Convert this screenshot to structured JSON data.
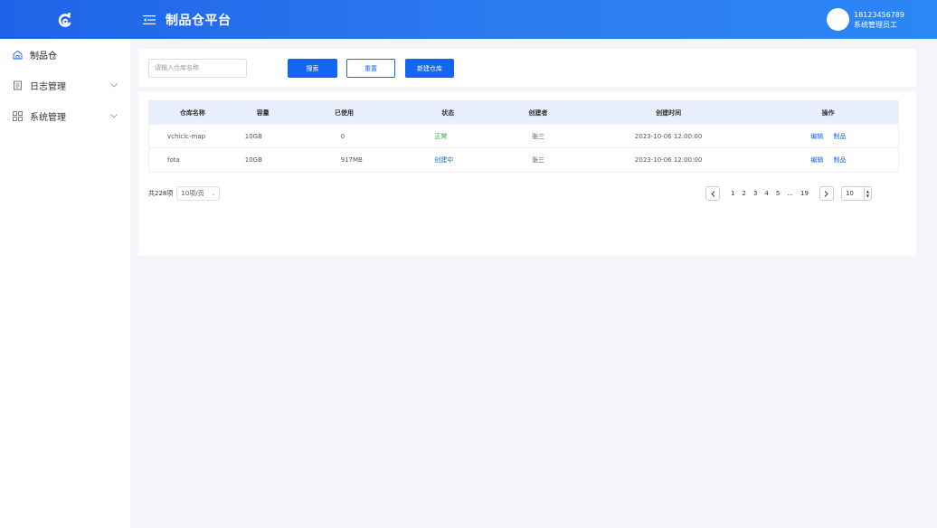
{
  "header": {
    "title": "制品仓平台",
    "user_phone": "18123456789",
    "user_role": "系统管理员工",
    "logo_icon": "brand-logo-icon",
    "menu_icon": "menu-fold-icon"
  },
  "sidebar": {
    "items": [
      {
        "label": "制品仓",
        "icon": "home-icon",
        "active": true
      },
      {
        "label": "日志管理",
        "icon": "document-icon",
        "expandable": true
      },
      {
        "label": "系统管理",
        "icon": "grid-icon",
        "expandable": true
      }
    ]
  },
  "search": {
    "placeholder": "请输入仓库名称",
    "search_label": "搜索",
    "reset_label": "重置",
    "new_label": "新建仓库"
  },
  "table": {
    "columns": [
      "仓库名称",
      "容量",
      "已使用",
      "状态",
      "创建者",
      "创建时间",
      "操作"
    ],
    "rows": [
      {
        "name": "vchiclc-map",
        "capacity": "10GB",
        "used": "0",
        "status": "正常",
        "creator": "张三",
        "created": "2023-10-06 12:00:00",
        "op1": "编辑",
        "op2": "制品"
      },
      {
        "name": "fota",
        "capacity": "10GB",
        "used": "917MB",
        "status": "创建中",
        "creator": "张三",
        "created": "2023-10-06 12:00:00",
        "op1": "编辑",
        "op2": "制品"
      }
    ]
  },
  "pagination": {
    "total": "共228项",
    "page_size": "10项/页",
    "pages": [
      "1",
      "2",
      "3",
      "4",
      "5",
      "...",
      "19"
    ],
    "jump_value": "10"
  },
  "colors": {
    "primary": "#1466f4",
    "status_ok": "#1ba14b",
    "header_gradient_start": "#1f63e8",
    "header_gradient_end": "#2b86f6"
  }
}
